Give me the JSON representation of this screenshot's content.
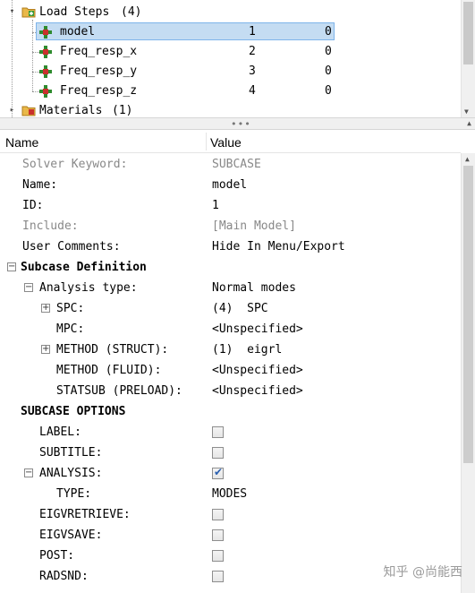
{
  "tree": {
    "load_steps": {
      "label": "Load Steps",
      "count": "(4)"
    },
    "items": [
      {
        "name": "model",
        "id": "1",
        "value": "0"
      },
      {
        "name": "Freq_resp_x",
        "id": "2",
        "value": "0"
      },
      {
        "name": "Freq_resp_y",
        "id": "3",
        "value": "0"
      },
      {
        "name": "Freq_resp_z",
        "id": "4",
        "value": "0"
      }
    ],
    "materials": {
      "label": "Materials",
      "count": "(1)"
    }
  },
  "splitter": {
    "grip": "•••"
  },
  "grid": {
    "header": {
      "name": "Name",
      "value": "Value"
    },
    "rows": {
      "solver_keyword": {
        "name": "Solver Keyword:",
        "value": "SUBCASE"
      },
      "name": {
        "name": "Name:",
        "value": "model"
      },
      "id": {
        "name": "ID:",
        "value": "1"
      },
      "include": {
        "name": "Include:",
        "value": "[Main Model]"
      },
      "user_comments": {
        "name": "User Comments:",
        "value": "Hide In Menu/Export"
      },
      "subcase_definition": {
        "name": "Subcase Definition"
      },
      "analysis_type": {
        "name": "Analysis type:",
        "value": "Normal modes"
      },
      "spc": {
        "name": "SPC:",
        "value": "(4)  SPC"
      },
      "mpc": {
        "name": "MPC:",
        "value": "<Unspecified>"
      },
      "method_struct": {
        "name": "METHOD (STRUCT):",
        "value": "(1)  eigrl"
      },
      "method_fluid": {
        "name": "METHOD (FLUID):",
        "value": "<Unspecified>"
      },
      "statsub": {
        "name": "STATSUB (PRELOAD):",
        "value": "<Unspecified>"
      },
      "subcase_options": {
        "name": "SUBCASE OPTIONS"
      },
      "label": {
        "name": "LABEL:",
        "checked": false
      },
      "subtitle": {
        "name": "SUBTITLE:",
        "checked": false
      },
      "analysis": {
        "name": "ANALYSIS:",
        "checked": true
      },
      "type": {
        "name": "TYPE:",
        "value": "MODES"
      },
      "eigvretrieve": {
        "name": "EIGVRETRIEVE:",
        "checked": false
      },
      "eigvsave": {
        "name": "EIGVSAVE:",
        "checked": false
      },
      "post": {
        "name": "POST:",
        "checked": false
      },
      "radsnd": {
        "name": "RADSND:",
        "checked": false
      }
    }
  },
  "watermark": "知乎 @尚能西",
  "colors": {
    "selection": "#c4dcf2",
    "selection_border": "#7eb4ea",
    "load_icon": "#2e8b2e",
    "folder": "#e6b24a"
  }
}
